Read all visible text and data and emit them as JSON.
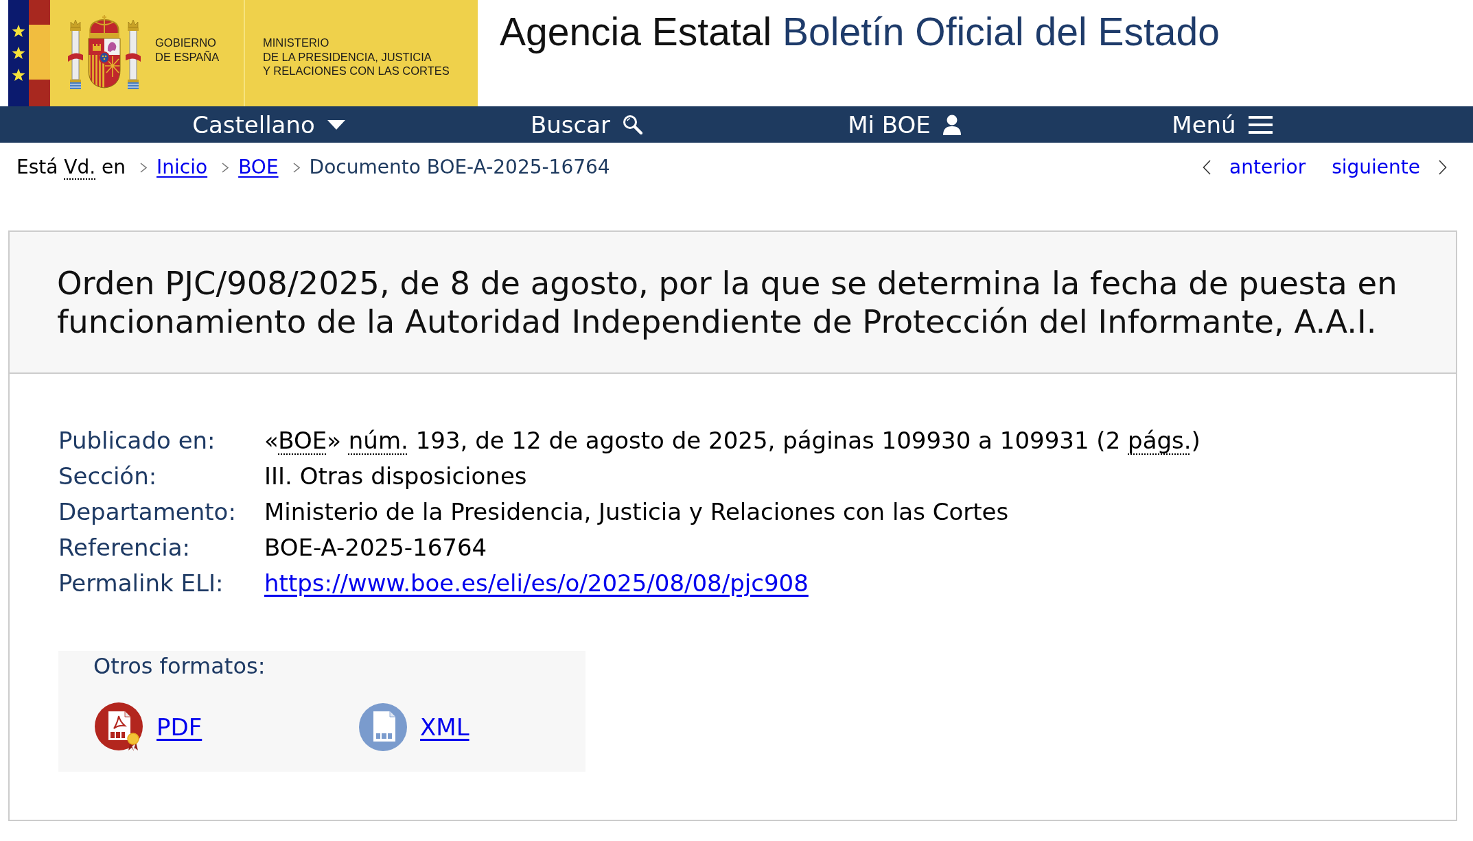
{
  "header": {
    "logo": {
      "government_lines": [
        "GOBIERNO",
        "DE ESPAÑA"
      ],
      "ministry_lines": [
        "MINISTERIO",
        "DE LA PRESIDENCIA, JUSTICIA",
        "Y RELACIONES CON LAS CORTES"
      ]
    },
    "site_title": {
      "prefix": "Agencia Estatal",
      "name": "Boletín Oficial del Estado"
    }
  },
  "nav": [
    {
      "label": "Castellano",
      "kind": "dropdown"
    },
    {
      "label": "Buscar",
      "kind": "search"
    },
    {
      "label": "Mi BOE",
      "kind": "account"
    },
    {
      "label": "Menú",
      "kind": "menu"
    }
  ],
  "breadcrumb": {
    "prefix": [
      {
        "text": "Está ",
        "abbr": false
      },
      {
        "text": "Vd.",
        "abbr": true
      },
      {
        "text": " en",
        "abbr": false
      }
    ],
    "items": [
      {
        "label": "Inicio",
        "kind": "link"
      },
      {
        "label": "BOE",
        "kind": "link"
      },
      {
        "label": "Documento BOE-A-2025-16764",
        "kind": "current"
      }
    ]
  },
  "pager": [
    {
      "label": "anterior",
      "kind": "previous"
    },
    {
      "label": "siguiente",
      "kind": "next"
    }
  ],
  "document": {
    "title": "Orden PJC/908/2025, de 8 de agosto, por la que se determina la fecha de puesta en funcionamiento de la Autoridad Independiente de Protección del Informante, A.A.I.",
    "details": [
      {
        "label": "Publicado en:",
        "kind": "text",
        "parts": [
          {
            "text": "«",
            "abbr": false
          },
          {
            "text": "BOE",
            "abbr": true
          },
          {
            "text": "» ",
            "abbr": false
          },
          {
            "text": "núm.",
            "abbr": true
          },
          {
            "text": " 193, de 12 de agosto de 2025, páginas 109930 a 109931 (2 ",
            "abbr": false
          },
          {
            "text": "págs.",
            "abbr": true
          },
          {
            "text": ")",
            "abbr": false
          }
        ]
      },
      {
        "label": "Sección:",
        "kind": "text",
        "parts": [
          {
            "text": "III. Otras disposiciones",
            "abbr": false
          }
        ]
      },
      {
        "label": "Departamento:",
        "kind": "text",
        "parts": [
          {
            "text": "Ministerio de la Presidencia, Justicia y Relaciones con las Cortes",
            "abbr": false
          }
        ]
      },
      {
        "label": "Referencia:",
        "kind": "text",
        "parts": [
          {
            "text": "BOE-A-2025-16764",
            "abbr": false
          }
        ]
      },
      {
        "label": "Permalink ELI:",
        "kind": "link",
        "parts": [
          {
            "text": "https://www.boe.es/eli/es/o/2025/08/08/pjc908",
            "abbr": false
          }
        ]
      }
    ],
    "other_formats": {
      "heading": "Otros formatos:",
      "items": [
        {
          "label": "PDF",
          "kind": "pdf"
        },
        {
          "label": "XML",
          "kind": "xml"
        }
      ]
    }
  }
}
